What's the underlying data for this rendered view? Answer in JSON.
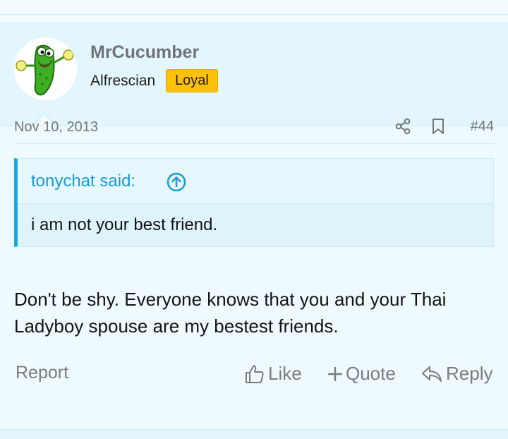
{
  "user": {
    "name": "MrCucumber",
    "title": "Alfrescian",
    "badge": "Loyal",
    "avatar_icon": "cucumber-mascot-icon"
  },
  "meta": {
    "date": "Nov 10, 2013",
    "post_number": "#44",
    "share_icon": "share-icon",
    "bookmark_icon": "bookmark-icon"
  },
  "quote": {
    "author": "tonychat said:",
    "text": "i am not your best friend.",
    "jump_icon": "arrow-up-circle-icon"
  },
  "message": {
    "text": "Don't be shy. Everyone knows that you and your Thai Ladyboy spouse are my bestest friends."
  },
  "actions": {
    "report": "Report",
    "like": "Like",
    "quote": "Quote",
    "reply": "Reply"
  },
  "colors": {
    "accent": "#1a9ad6",
    "badge": "#ffc107",
    "user_block_bg": "#e3f6fd",
    "post_bg": "#effaff"
  }
}
